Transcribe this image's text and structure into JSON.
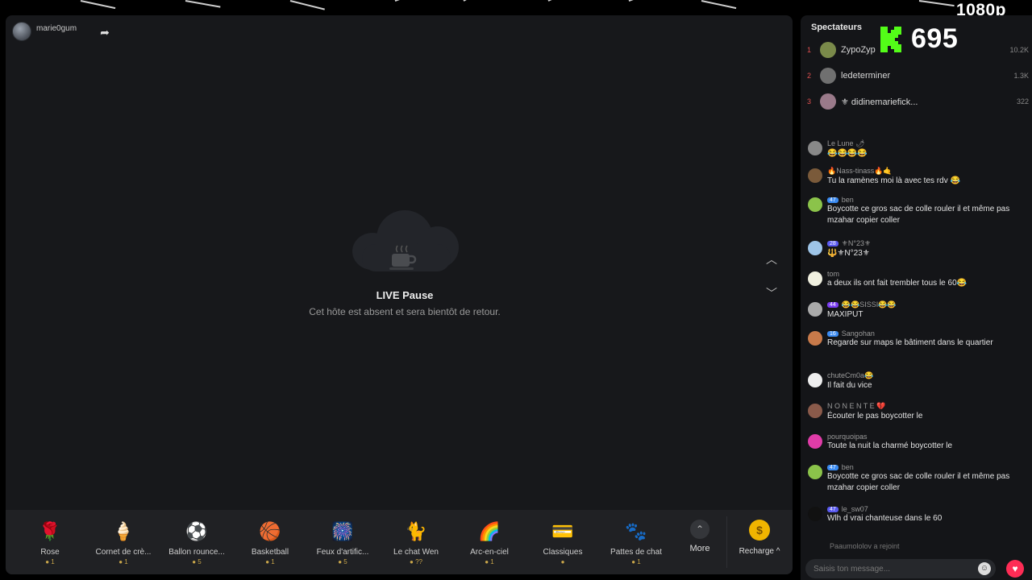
{
  "overlay": {
    "resolution": "1080p"
  },
  "player": {
    "host_name": "marie0gum",
    "pause_title": "LIVE Pause",
    "pause_subtitle": "Cet hôte est absent et sera bientôt de retour."
  },
  "gifts": [
    {
      "name": "Rose",
      "price": "1",
      "icon": "rose-icon",
      "glyph": "🌹",
      "color": "#d81e3a"
    },
    {
      "name": "Cornet de crè...",
      "price": "1",
      "icon": "ice-cream-icon",
      "glyph": "🍦",
      "color": "#f2b6c8"
    },
    {
      "name": "Ballon rounce...",
      "price": "5",
      "icon": "soccer-ball-icon",
      "glyph": "⚽",
      "color": "#e8e8e8"
    },
    {
      "name": "Basketball",
      "price": "1",
      "icon": "basketball-icon",
      "glyph": "🏀",
      "color": "#e0562a"
    },
    {
      "name": "Feux d'artific...",
      "price": "5",
      "icon": "fireworks-icon",
      "glyph": "🎆",
      "color": "#6a4cf0"
    },
    {
      "name": "Le chat Wen",
      "price": "??",
      "icon": "cat-icon",
      "glyph": "🐈",
      "color": "#f5f5f5"
    },
    {
      "name": "Arc-en-ciel",
      "price": "1",
      "icon": "rainbow-icon",
      "glyph": "🌈",
      "color": "#ffcc33"
    },
    {
      "name": "Classiques",
      "price": "",
      "icon": "gift-card-icon",
      "glyph": "💳",
      "color": "#8a5cd6"
    },
    {
      "name": "Pattes de chat",
      "price": "1",
      "icon": "cat-paws-icon",
      "glyph": "🐾",
      "color": "#f0c8c8"
    }
  ],
  "more_label": "More",
  "recharge_label": "Recharge ^",
  "sidebar": {
    "spectators_label": "Spectateurs",
    "viewer_count": "695",
    "top_viewers": [
      {
        "rank": "1",
        "name": "ZypoZyp",
        "score": "10.2K",
        "color": "#7a8a4a"
      },
      {
        "rank": "2",
        "name": "ledeterminer",
        "score": "1.3K",
        "color": "#707070"
      },
      {
        "rank": "3",
        "name": "⚜ didinemariefick...",
        "score": "322",
        "color": "#9a7a8a"
      }
    ],
    "chat": [
      {
        "user": "Le Lune 🌶",
        "level": "",
        "text": "😂😂😂😂",
        "color": "#888"
      },
      {
        "user": "🔥Nass-tinass🔥🤙",
        "level": "",
        "text": "Tu la ramènes moi là avec tes rdv 😂",
        "color": "#7a5a3a"
      },
      {
        "user": "ben",
        "level": "47",
        "text": "Boycotte ce gros sac de colle rouler il et même pas mzahar copier coller",
        "color": "#8bc34a"
      },
      {
        "user": "⚜N°23⚜",
        "level": "28",
        "text": "🔱⚜N°23⚜",
        "color": "#9ec5e8"
      },
      {
        "user": "tom",
        "level": "",
        "text": "a deux ils ont fait trembler tous le 60😂",
        "color": "#f0f0e0"
      },
      {
        "user": "😂😂SISSI😂😂",
        "level": "44",
        "text": "MAXIPUT",
        "color": "#aaa"
      },
      {
        "user": "Sangohan",
        "level": "16",
        "text": "Regarde sur maps le bâtiment dans le quartier",
        "color": "#c87a4a"
      },
      {
        "user": "chuteCm0a😂",
        "level": "",
        "text": "Il fait du vice",
        "color": "#eee"
      },
      {
        "user": "N O N E N T E 💔",
        "level": "",
        "text": "Écouter le pas boycotter le",
        "color": "#8a5a4a"
      },
      {
        "user": "pourquoipas",
        "level": "",
        "text": "Toute la nuit la charmé boycotter le",
        "color": "#e03ca8"
      },
      {
        "user": "ben",
        "level": "47",
        "text": "Boycotte ce gros sac de colle rouler il et même pas mzahar copier coller",
        "color": "#8bc34a"
      },
      {
        "user": "le_sw07",
        "level": "47",
        "text": "Wlh d vrai chanteuse dans le 60",
        "color": "#111"
      }
    ],
    "joined_text": "Paaumololov  a rejoint",
    "input_placeholder": "Saisis ton message..."
  }
}
